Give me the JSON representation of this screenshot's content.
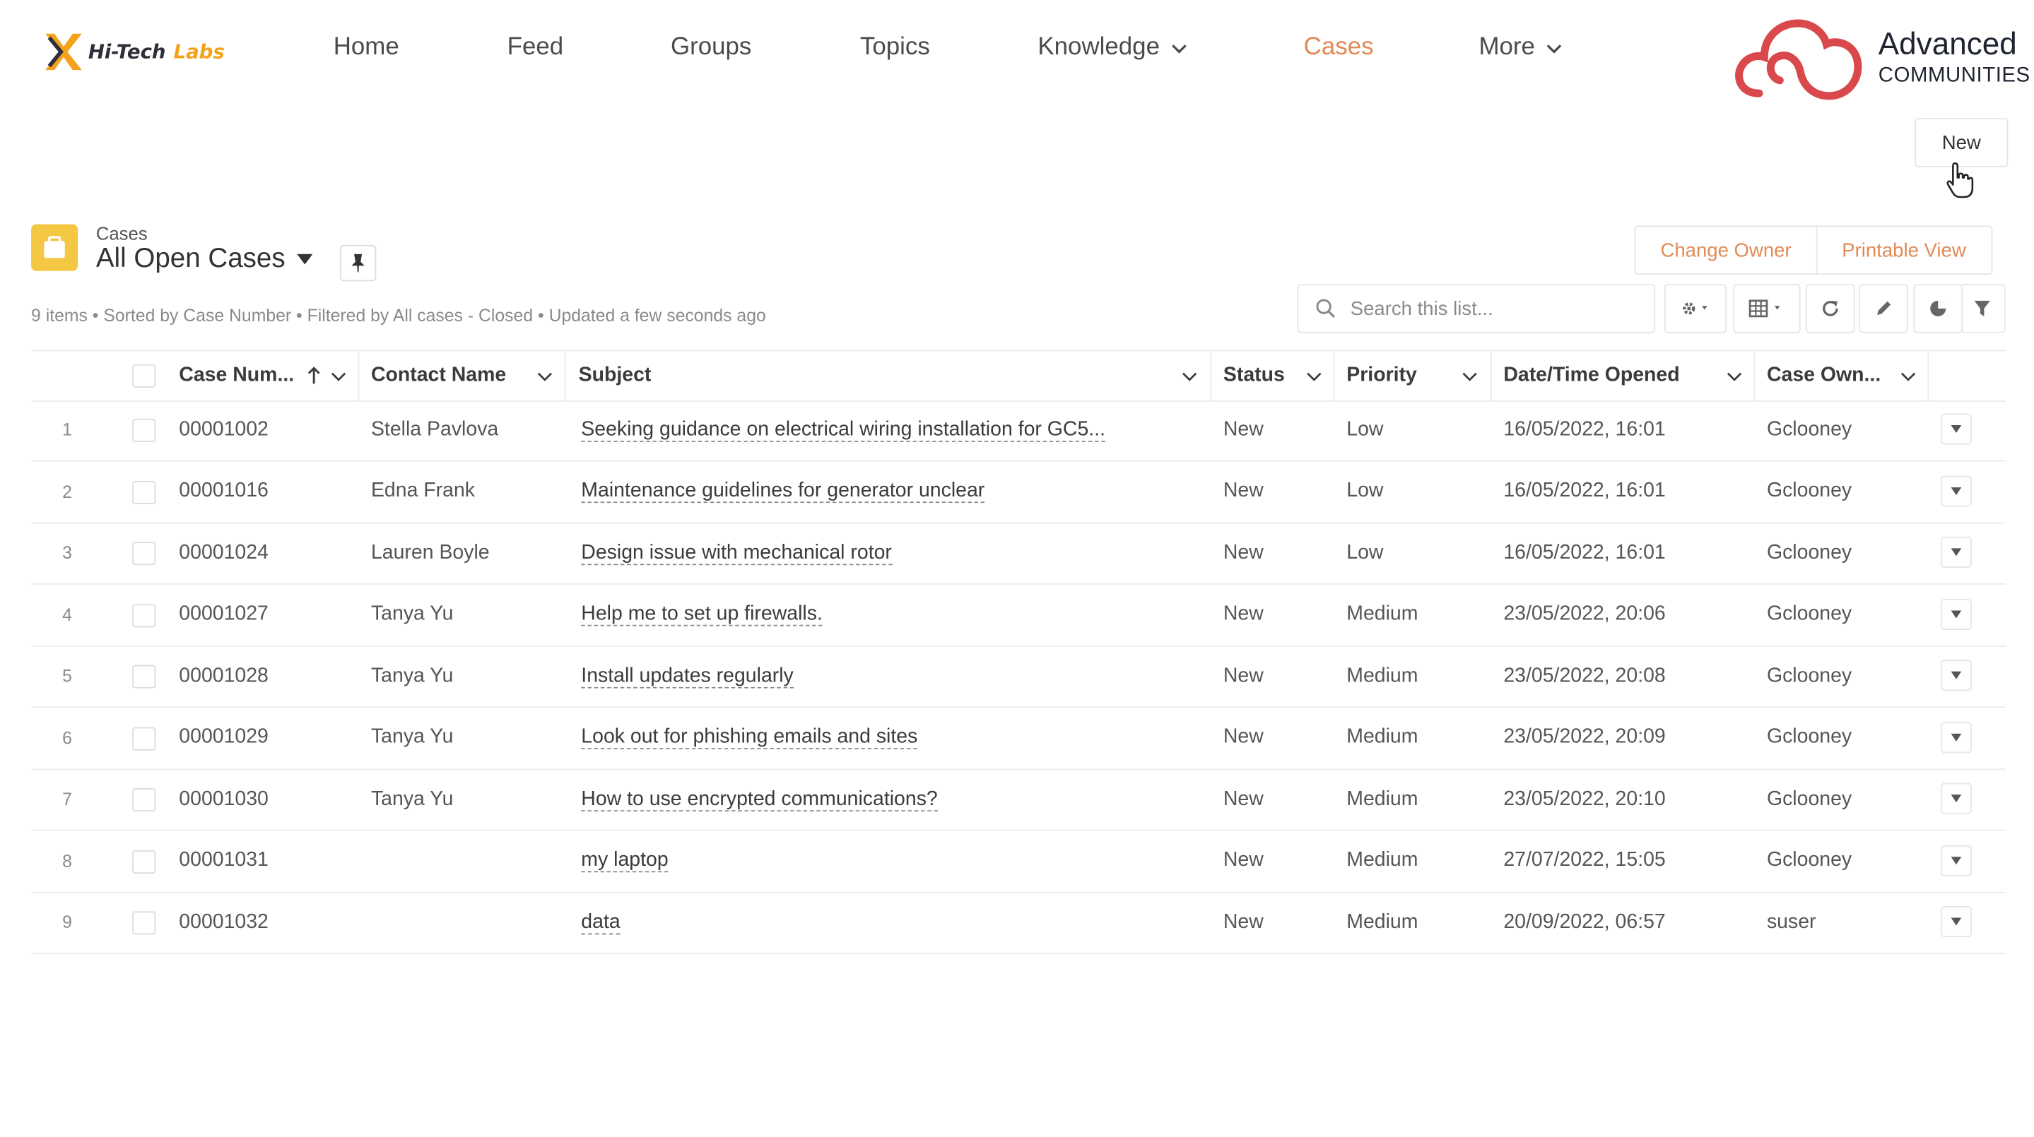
{
  "header": {
    "logo": {
      "word1": "Hi-Tech",
      "word2": "Labs"
    },
    "nav": [
      {
        "label": "Home"
      },
      {
        "label": "Feed"
      },
      {
        "label": "Groups"
      },
      {
        "label": "Topics"
      },
      {
        "label": "Knowledge",
        "dropdown": true
      },
      {
        "label": "Cases",
        "active": true
      },
      {
        "label": "More",
        "dropdown": true
      }
    ],
    "brand": {
      "line1": "Advanced",
      "line2": "COMMUNITIES"
    }
  },
  "actions": {
    "new_label": "New",
    "change_owner_label": "Change Owner",
    "printable_view_label": "Printable View"
  },
  "list": {
    "object_label": "Cases",
    "view_name": "All Open Cases",
    "summary": "9 items • Sorted by Case Number • Filtered by All cases - Closed • Updated a few seconds ago",
    "search_placeholder": "Search this list..."
  },
  "columns": {
    "case_number": "Case Num...",
    "contact_name": "Contact Name",
    "subject": "Subject",
    "status": "Status",
    "priority": "Priority",
    "opened": "Date/Time Opened",
    "owner": "Case Own..."
  },
  "rows": [
    {
      "n": "1",
      "case": "00001002",
      "contact": "Stella Pavlova",
      "subject": "Seeking guidance on electrical wiring installation for GC5...",
      "status": "New",
      "priority": "Low",
      "opened": "16/05/2022, 16:01",
      "owner": "Gclooney"
    },
    {
      "n": "2",
      "case": "00001016",
      "contact": "Edna Frank",
      "subject": "Maintenance guidelines for generator unclear",
      "status": "New",
      "priority": "Low",
      "opened": "16/05/2022, 16:01",
      "owner": "Gclooney"
    },
    {
      "n": "3",
      "case": "00001024",
      "contact": "Lauren Boyle",
      "subject": "Design issue with mechanical rotor",
      "status": "New",
      "priority": "Low",
      "opened": "16/05/2022, 16:01",
      "owner": "Gclooney"
    },
    {
      "n": "4",
      "case": "00001027",
      "contact": "Tanya Yu",
      "subject": "Help me to set up firewalls.",
      "status": "New",
      "priority": "Medium",
      "opened": "23/05/2022, 20:06",
      "owner": "Gclooney"
    },
    {
      "n": "5",
      "case": "00001028",
      "contact": "Tanya Yu",
      "subject": "Install updates regularly",
      "status": "New",
      "priority": "Medium",
      "opened": "23/05/2022, 20:08",
      "owner": "Gclooney"
    },
    {
      "n": "6",
      "case": "00001029",
      "contact": "Tanya Yu",
      "subject": "Look out for phishing emails and sites",
      "status": "New",
      "priority": "Medium",
      "opened": "23/05/2022, 20:09",
      "owner": "Gclooney"
    },
    {
      "n": "7",
      "case": "00001030",
      "contact": "Tanya Yu",
      "subject": "How to use encrypted communications?",
      "status": "New",
      "priority": "Medium",
      "opened": "23/05/2022, 20:10",
      "owner": "Gclooney"
    },
    {
      "n": "8",
      "case": "00001031",
      "contact": "",
      "subject": "my laptop",
      "status": "New",
      "priority": "Medium",
      "opened": "27/07/2022, 15:05",
      "owner": "Gclooney"
    },
    {
      "n": "9",
      "case": "00001032",
      "contact": "",
      "subject": "data",
      "status": "New",
      "priority": "Medium",
      "opened": "20/09/2022, 06:57",
      "owner": "suser"
    }
  ],
  "colors": {
    "accent": "#e08a55",
    "object_icon": "#f4c842",
    "brand": "#d9484a"
  }
}
